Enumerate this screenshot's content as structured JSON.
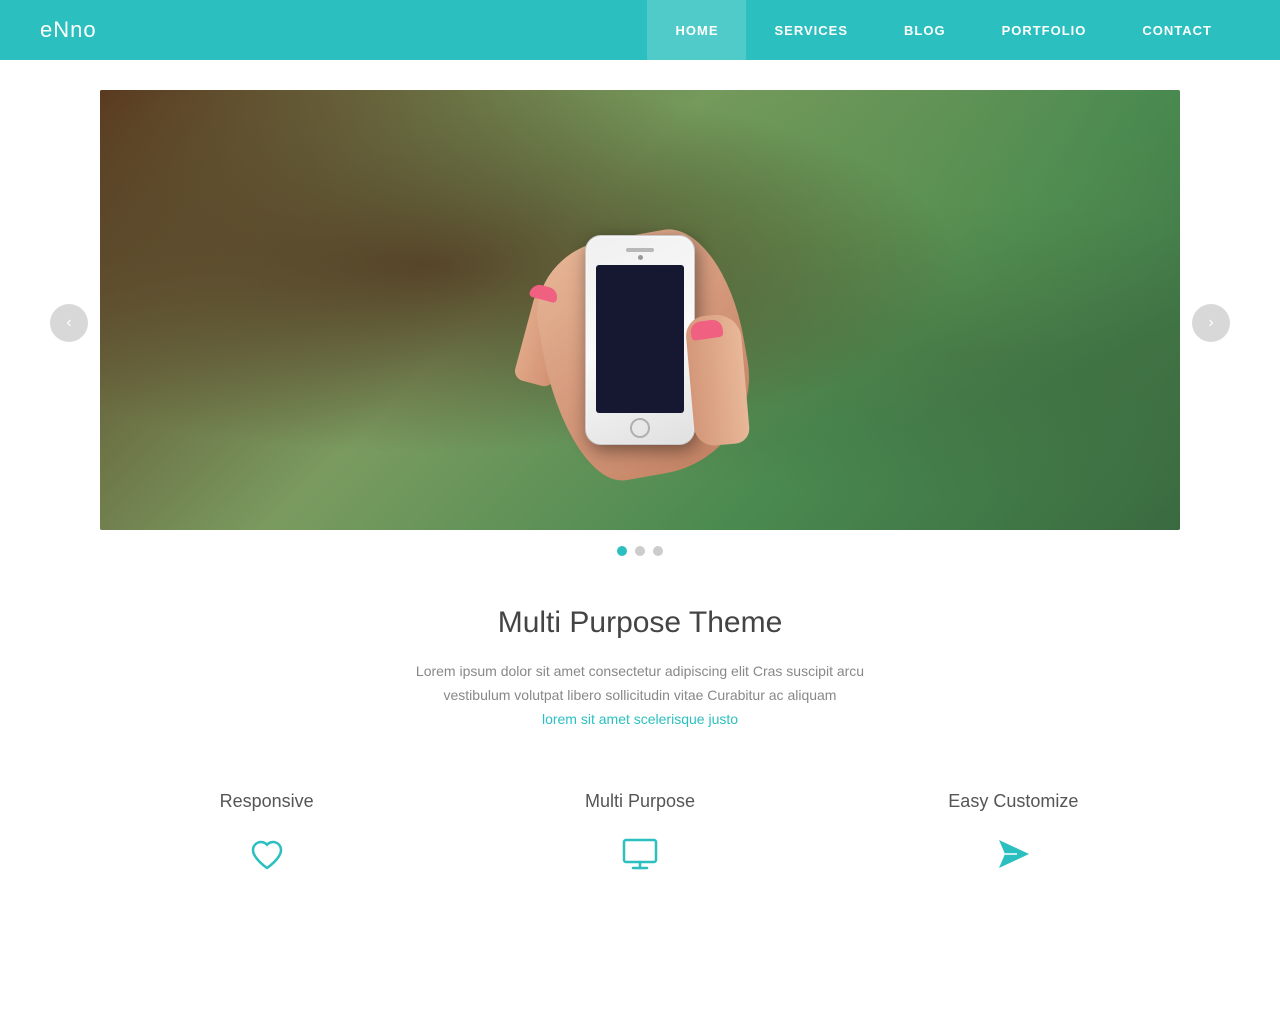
{
  "nav": {
    "logo": "eNno",
    "links": [
      {
        "label": "HOME",
        "active": true
      },
      {
        "label": "SERVICES",
        "active": false
      },
      {
        "label": "BLOG",
        "active": false
      },
      {
        "label": "PORTFOLIO",
        "active": false
      },
      {
        "label": "CONTACT",
        "active": false
      }
    ]
  },
  "slider": {
    "prev_label": "‹",
    "next_label": "›",
    "dots": [
      {
        "active": true
      },
      {
        "active": false
      },
      {
        "active": false
      }
    ]
  },
  "main": {
    "title": "Multi Purpose Theme",
    "description_line1": "Lorem ipsum dolor sit amet consectetur adipiscing elit Cras suscipit arcu",
    "description_line2": "vestibulum volutpat libero sollicitudin vitae Curabitur ac aliquam",
    "description_line3": "lorem sit amet scelerisque justo"
  },
  "features": [
    {
      "title": "Responsive",
      "icon": "heart"
    },
    {
      "title": "Multi Purpose",
      "icon": "monitor"
    },
    {
      "title": "Easy Customize",
      "icon": "send"
    }
  ]
}
